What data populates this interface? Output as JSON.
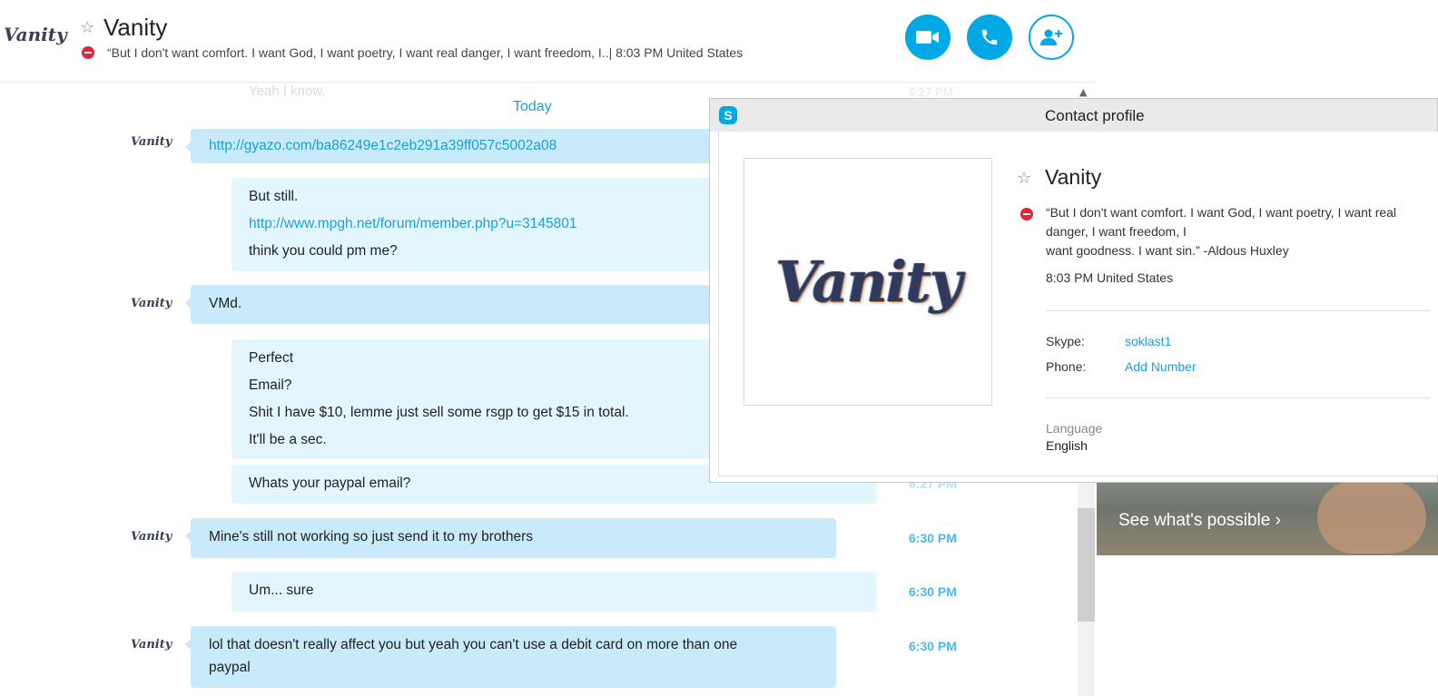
{
  "header": {
    "avatar_text": "Vanity",
    "name": "Vanity",
    "mood": "“But I don't want comfort. I want God, I want poetry, I want real danger, I want freedom, I..|  8:03 PM United States",
    "status": "do-not-disturb",
    "buttons": [
      "video-call",
      "voice-call",
      "add-people"
    ]
  },
  "chat": {
    "faded_message": "Yeah I know.",
    "faded_time": "6:27 PM",
    "date_separator": "Today",
    "messages": [
      {
        "from": "contact",
        "avatar": "Vanity",
        "lines": [
          "http://gyazo.com/ba86249e1c2eb291a39ff057c5002a08"
        ]
      },
      {
        "from": "me",
        "lines": [
          "But still.",
          "http://www.mpgh.net/forum/member.php?u=3145801",
          "think you could pm me?"
        ]
      },
      {
        "from": "contact",
        "avatar": "Vanity",
        "lines": [
          "VMd."
        ]
      },
      {
        "from": "me",
        "lines": [
          "Perfect",
          "Email?",
          "Shit I have $10, lemme just sell some rsgp to get $15 in total.",
          "It'll be a sec."
        ]
      },
      {
        "from": "me",
        "lines": [
          "Whats your paypal email?"
        ],
        "time": "6:27 PM"
      },
      {
        "from": "contact",
        "avatar": "Vanity",
        "lines": [
          "Mine's still not working so just send it to my brothers"
        ],
        "time": "6:30 PM"
      },
      {
        "from": "me",
        "lines": [
          "Um... sure"
        ],
        "time": "6:30 PM"
      },
      {
        "from": "contact",
        "avatar": "Vanity",
        "lines": [
          "lol that doesn't really affect you but yeah you can't use a debit card on more than one",
          "paypal"
        ],
        "time": "6:30 PM"
      }
    ]
  },
  "promo": {
    "text": "See what's possible ›"
  },
  "contact_profile": {
    "title": "Contact profile",
    "picture_text": "Vanity",
    "name": "Vanity",
    "mood_lines": [
      "“But I don't want comfort. I want God, I want poetry, I want real",
      "danger, I want freedom, I",
      "want goodness. I want sin.” -Aldous Huxley"
    ],
    "local_time": "8:03 PM United States",
    "skype_label": "Skype:",
    "skype_value": "soklast1",
    "phone_label": "Phone:",
    "phone_value": "Add Number",
    "language_label": "Language",
    "language_value": "English"
  },
  "colors": {
    "accent": "#00a8e6",
    "link": "#1a9fd9",
    "incoming_bubble": "#c8eafa",
    "outgoing_bubble": "#e3f5fd",
    "dnd_red": "#e0263a"
  }
}
